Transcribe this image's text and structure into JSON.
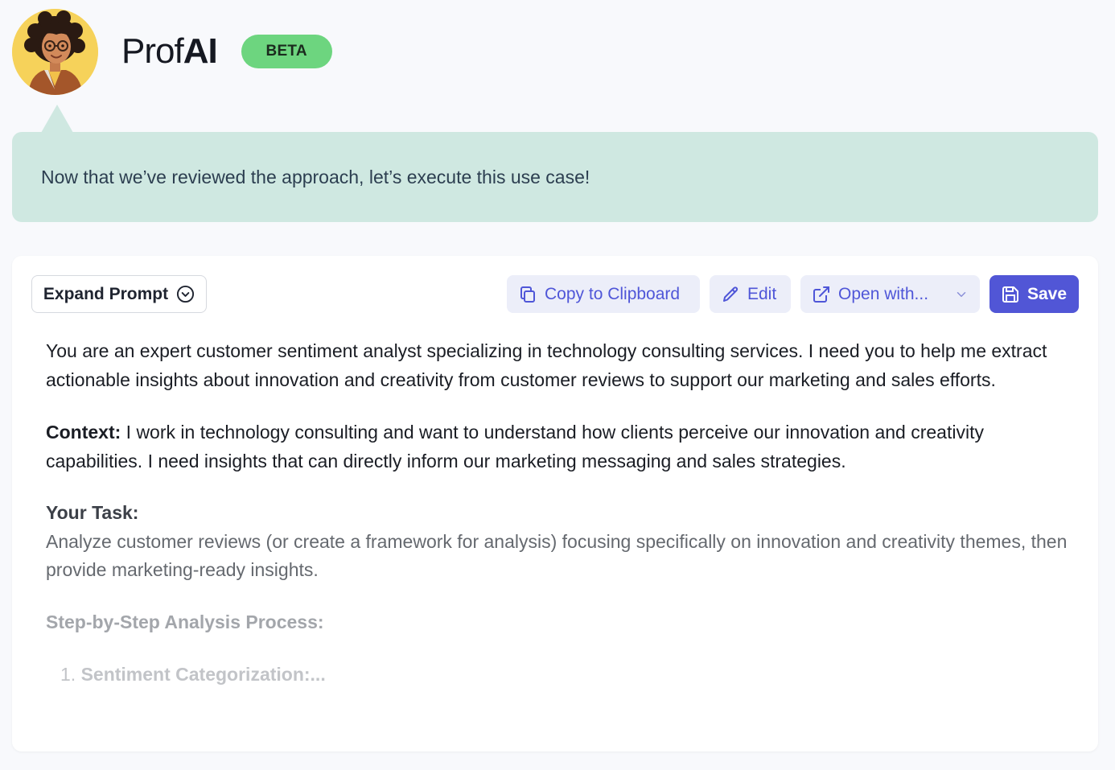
{
  "header": {
    "brand_prefix": "Prof",
    "brand_suffix": "AI",
    "badge": "BETA"
  },
  "bubble": {
    "message": "Now that we’ve reviewed the approach, let’s execute this use case!"
  },
  "toolbar": {
    "expand_label": "Expand Prompt",
    "copy_label": "Copy to Clipboard",
    "edit_label": "Edit",
    "open_label": "Open with...",
    "save_label": "Save"
  },
  "prompt": {
    "intro": "You are an expert customer sentiment analyst specializing in technology consulting services. I need you to help me extract actionable insights about innovation and creativity from customer reviews to support our marketing and sales efforts.",
    "context_label": "Context:",
    "context_text": " I work in technology consulting and want to understand how clients perceive our innovation and creativity capabilities. I need insights that can directly inform our marketing messaging and sales strategies.",
    "task_label": "Your Task:",
    "task_text": "Analyze customer reviews (or create a framework for analysis) focusing specifically on innovation and creativity themes, then provide marketing-ready insights.",
    "steps_label": "Step-by-Step Analysis Process:",
    "step1_number": "1.",
    "step1_label": "Sentiment Categorization:..."
  },
  "colors": {
    "accent": "#5156d6",
    "accent_soft": "#eceef9",
    "bubble": "#cfe8e1",
    "badge": "#6dd57f",
    "avatar_bg": "#f6d25a"
  },
  "icons": {
    "expand": "chevron-down-circle-icon",
    "copy": "copy-icon",
    "edit": "pencil-icon",
    "open": "external-link-icon",
    "dropdown": "chevron-down-icon",
    "save": "floppy-disk-icon"
  }
}
